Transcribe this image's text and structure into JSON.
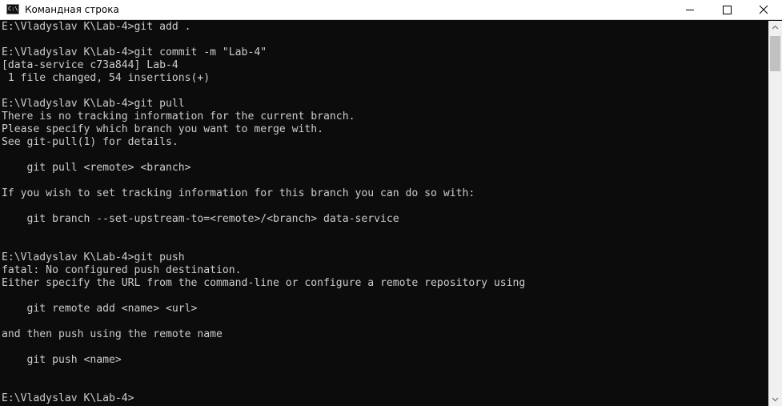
{
  "window": {
    "title": "Командная строка",
    "icon": "cmd-icon",
    "icon_text": "C:\\"
  },
  "controls": {
    "minimize_icon": "minimize-icon",
    "maximize_icon": "maximize-icon",
    "close_icon": "close-icon"
  },
  "colors": {
    "console_background": "#0c0c0c",
    "console_text": "#cccccc",
    "titlebar_background": "#ffffff",
    "scrollbar_track": "#f0f0f0",
    "scrollbar_thumb": "#c1c1c1"
  },
  "console": {
    "lines": [
      "E:\\Vladyslav K\\Lab-4>git add .",
      "",
      "E:\\Vladyslav K\\Lab-4>git commit -m \"Lab-4\"",
      "[data-service c73a844] Lab-4",
      " 1 file changed, 54 insertions(+)",
      "",
      "E:\\Vladyslav K\\Lab-4>git pull",
      "There is no tracking information for the current branch.",
      "Please specify which branch you want to merge with.",
      "See git-pull(1) for details.",
      "",
      "    git pull <remote> <branch>",
      "",
      "If you wish to set tracking information for this branch you can do so with:",
      "",
      "    git branch --set-upstream-to=<remote>/<branch> data-service",
      "",
      "",
      "E:\\Vladyslav K\\Lab-4>git push",
      "fatal: No configured push destination.",
      "Either specify the URL from the command-line or configure a remote repository using",
      "",
      "    git remote add <name> <url>",
      "",
      "and then push using the remote name",
      "",
      "    git push <name>",
      "",
      "",
      "E:\\Vladyslav K\\Lab-4>"
    ]
  },
  "scrollbar": {
    "up_icon": "scroll-up-arrow-icon",
    "down_icon": "scroll-down-arrow-icon"
  }
}
